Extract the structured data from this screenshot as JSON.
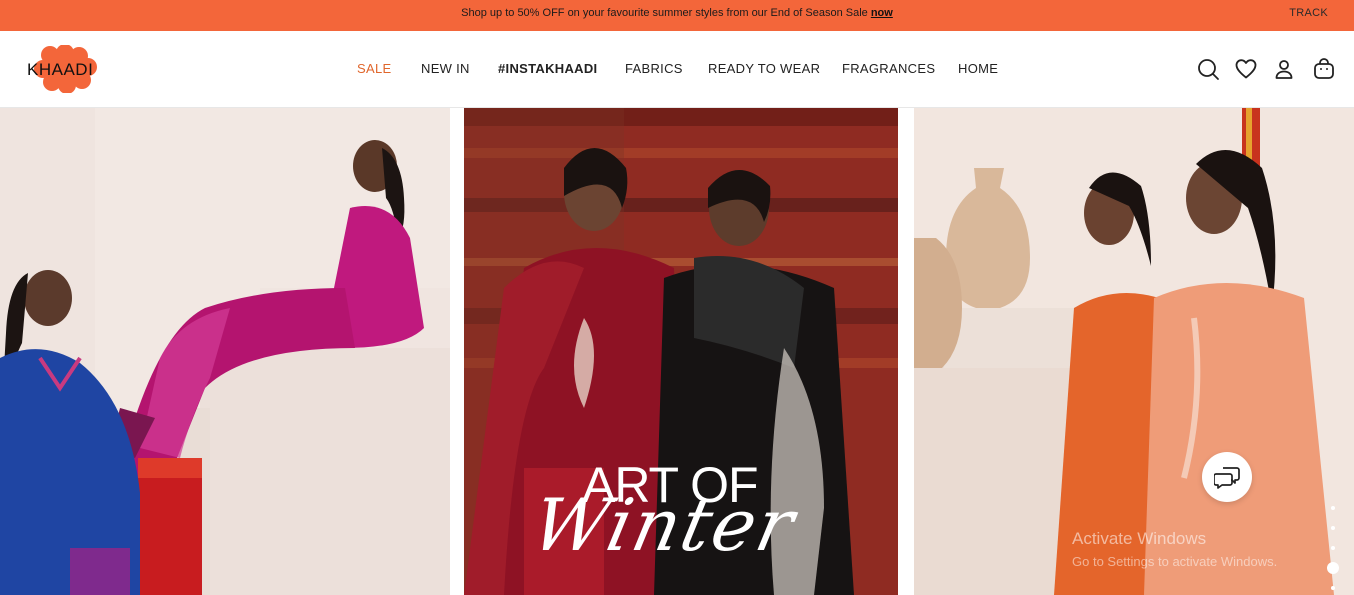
{
  "promo": {
    "text": "Shop up to 50% OFF on your favourite summer styles from our End of Season Sale",
    "link": "now",
    "track": "TRACK"
  },
  "brand": {
    "logo_text": "KHAADI",
    "accent": "#f3663a"
  },
  "nav": {
    "items": [
      {
        "label": "SALE"
      },
      {
        "label": "NEW IN"
      },
      {
        "label": "#INSTAKHAADI"
      },
      {
        "label": "FABRICS"
      },
      {
        "label": "READY TO WEAR"
      },
      {
        "label": "FRAGRANCES"
      },
      {
        "label": "HOME"
      }
    ]
  },
  "header_icons": [
    "search-icon",
    "heart-icon",
    "user-icon",
    "bag-icon"
  ],
  "hero": {
    "title": "ART OF",
    "script": "Winter",
    "slide_count": 6,
    "active_slide": 4
  },
  "chat": {
    "icon": "chat-icon"
  },
  "watermark": {
    "title": "Activate Windows",
    "subtitle": "Go to Settings to activate Windows."
  }
}
